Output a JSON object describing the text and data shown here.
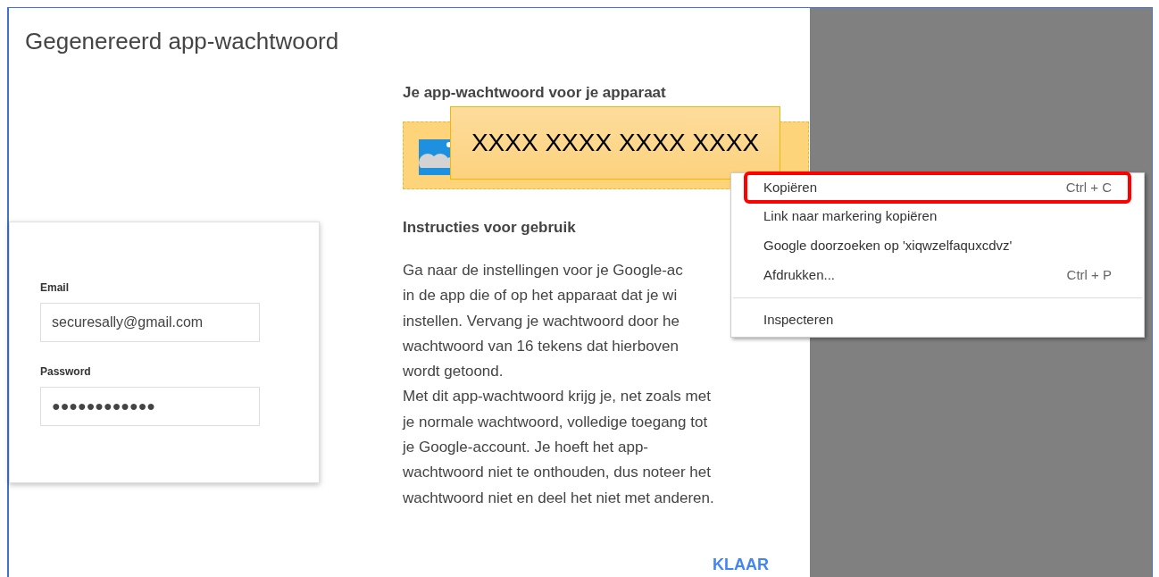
{
  "dialog": {
    "title": "Gegenereerd app-wachtwoord",
    "login_card": {
      "fields": [
        {
          "label": "Email",
          "value": "securesally@gmail.com"
        },
        {
          "label": "Password",
          "value": "●●●●●●●●●●●●"
        }
      ]
    },
    "password_heading": "Je app-wachtwoord voor je apparaat",
    "password_value": "XXXX XXXX XXXX XXXX",
    "instructions_heading": "Instructies voor gebruik",
    "instructions_lines": [
      "Ga naar de instellingen voor je Google-ac",
      "in de app die of op het apparaat dat je wi",
      "instellen. Vervang je wachtwoord door he",
      "wachtwoord van 16 tekens dat hierboven",
      "wordt getoond.",
      "Met dit app-wachtwoord krijg je, net zoals met",
      "je normale wachtwoord, volledige toegang tot",
      "je Google-account. Je hoeft het app-",
      "wachtwoord niet te onthouden, dus noteer het",
      "wachtwoord niet en deel het niet met anderen."
    ],
    "done_button": "KLAAR"
  },
  "context_menu": {
    "groups": [
      [
        {
          "label": "Kopiëren",
          "shortcut": "Ctrl + C",
          "highlighted": true
        },
        {
          "label": "Link naar markering kopiëren",
          "highlighted": false
        },
        {
          "label": "Google doorzoeken op 'xiqwzelfaquxcdvz'",
          "highlighted": false
        },
        {
          "label": "Afdrukken...",
          "shortcut": "Ctrl + P",
          "highlighted": false
        }
      ],
      [
        {
          "label": "Inspecteren",
          "highlighted": false
        }
      ]
    ]
  }
}
